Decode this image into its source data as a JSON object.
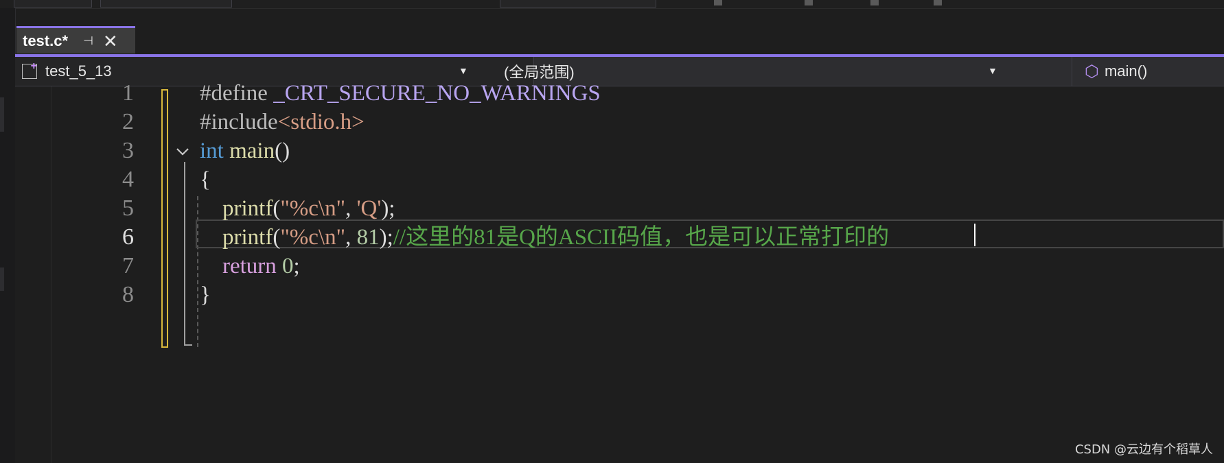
{
  "tab": {
    "title": "test.c*",
    "pin_glyph": "⊣",
    "close_glyph": "✕"
  },
  "navbar": {
    "project": "test_5_13",
    "scope": "(全局范围)",
    "function": "main()"
  },
  "editor": {
    "line_numbers": [
      "1",
      "2",
      "3",
      "4",
      "5",
      "6",
      "7",
      "8"
    ],
    "active_line": "6",
    "lines": {
      "l1": {
        "directive": "#define ",
        "name": "_CRT_SECURE_NO_WARNINGS"
      },
      "l2": {
        "directive": "#include",
        "header": "<stdio.h>"
      },
      "l3": {
        "kw": "int",
        "sp": " ",
        "fn": "main",
        "punc": "()"
      },
      "l4": {
        "punc": "{"
      },
      "l5": {
        "indent": "    ",
        "fn": "printf",
        "open": "(",
        "str": "\"%c\\n\"",
        "comma": ", ",
        "chr": "'Q'",
        "close": ");"
      },
      "l6": {
        "indent": "    ",
        "fn": "printf",
        "open": "(",
        "str": "\"%c\\n\"",
        "comma": ", ",
        "num": "81",
        "close": ");",
        "comment": "//这里的81是Q的ASCII码值，也是可以正常打印的"
      },
      "l7": {
        "indent": "    ",
        "kw": "return",
        "sp": " ",
        "num": "0",
        "close": ";"
      },
      "l8": {
        "punc": "}"
      }
    }
  },
  "watermark": "CSDN @云边有个稻草人"
}
